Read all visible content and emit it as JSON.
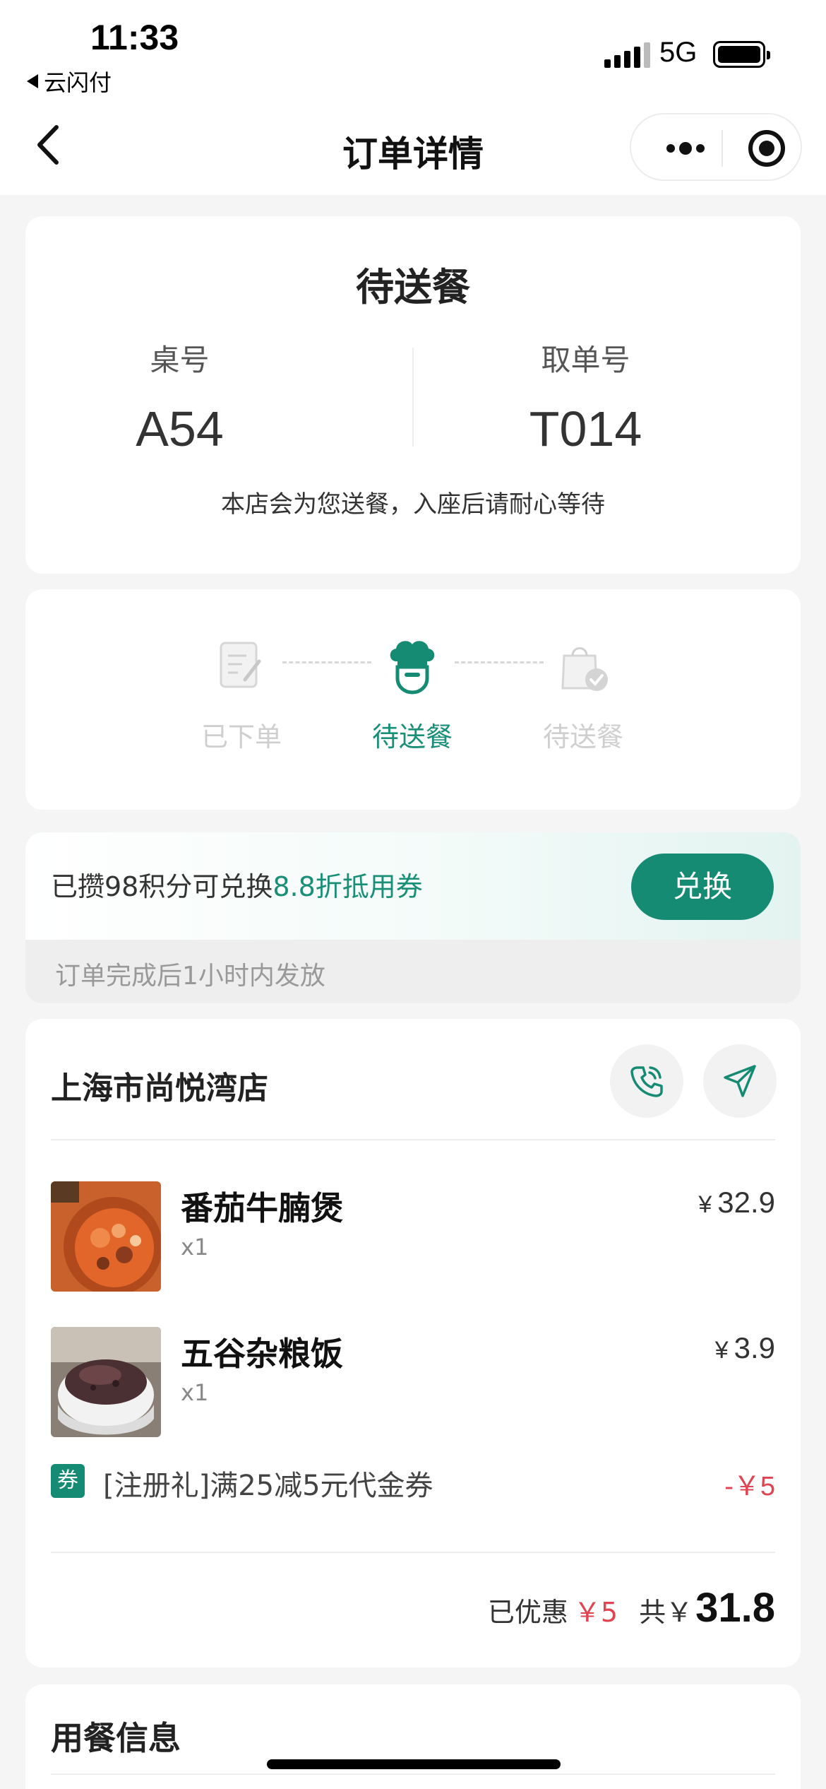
{
  "status_bar": {
    "time": "11:33",
    "back_app": "云闪付",
    "network": "5G"
  },
  "nav": {
    "title": "订单详情"
  },
  "order_status": {
    "title": "待送餐",
    "table_label": "桌号",
    "table_value": "A54",
    "ticket_label": "取单号",
    "ticket_value": "T014",
    "notice": "本店会为您送餐，入座后请耐心等待"
  },
  "progress": {
    "steps": [
      {
        "label": "已下单",
        "state": "done",
        "icon": "order-note-icon"
      },
      {
        "label": "待送餐",
        "state": "current",
        "icon": "chef-hat-icon"
      },
      {
        "label": "待送餐",
        "state": "pending",
        "icon": "bag-check-icon"
      }
    ]
  },
  "points": {
    "text_prefix": "已攒98积分可兑换",
    "text_highlight": "8.8折抵用券",
    "button": "兑换",
    "subtext": "订单完成后1小时内发放"
  },
  "order": {
    "store_name": "上海市尚悦湾店",
    "items": [
      {
        "name": "番茄牛腩煲",
        "qty": "x1",
        "currency": "¥",
        "price": "32.9"
      },
      {
        "name": "五谷杂粮饭",
        "qty": "x1",
        "currency": "¥",
        "price": "3.9"
      }
    ],
    "coupon": {
      "tag": "券",
      "desc": "[注册礼]满25减5元代金券",
      "amount": "-￥5"
    },
    "summary": {
      "discount_label": "已优惠",
      "discount_value": "￥5",
      "total_label": "共￥",
      "total_value": "31.8"
    }
  },
  "dining_info": {
    "title": "用餐信息"
  },
  "colors": {
    "accent": "#168b74",
    "price_red": "#e04451"
  }
}
